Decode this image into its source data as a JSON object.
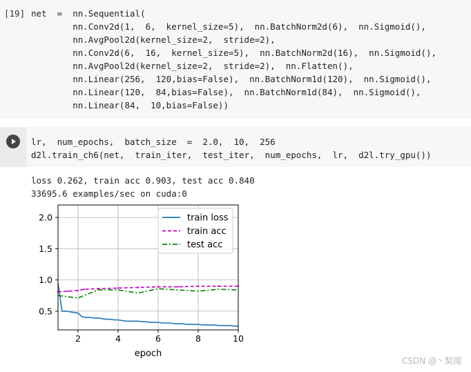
{
  "cell1": {
    "prompt": "[19]",
    "lines": [
      "net  =  nn.Sequential(",
      "        nn.Conv2d(1,  6,  kernel_size=5),  nn.BatchNorm2d(6),  nn.Sigmoid(),",
      "        nn.AvgPool2d(kernel_size=2,  stride=2),",
      "        nn.Conv2d(6,  16,  kernel_size=5),  nn.BatchNorm2d(16),  nn.Sigmoid(),",
      "        nn.AvgPool2d(kernel_size=2,  stride=2),  nn.Flatten(),",
      "        nn.Linear(256,  120,bias=False),  nn.BatchNorm1d(120),  nn.Sigmoid(),",
      "        nn.Linear(120,  84,bias=False),  nn.BatchNorm1d(84),  nn.Sigmoid(),",
      "        nn.Linear(84,  10,bias=False))"
    ]
  },
  "cell2": {
    "lines": [
      "lr,  num_epochs,  batch_size  =  2.0,  10,  256",
      "d2l.train_ch6(net,  train_iter,  test_iter,  num_epochs,  lr,  d2l.try_gpu())"
    ]
  },
  "output": {
    "line1": "loss 0.262, train acc 0.903, test acc 0.840",
    "line2": "33695.6 examples/sec on cuda:0"
  },
  "chart_data": {
    "type": "line",
    "xlabel": "epoch",
    "ylabel": "",
    "xlim": [
      1,
      10
    ],
    "ylim": [
      0.2,
      2.2
    ],
    "xticks": [
      "2",
      "4",
      "6",
      "8",
      "10"
    ],
    "yticks": [
      "0.5",
      "1.0",
      "1.5",
      "2.0"
    ],
    "grid": true,
    "legend_position": "top-right",
    "series": [
      {
        "name": "train loss",
        "color": "#1f77b4",
        "style": "solid",
        "x": [
          1.0,
          1.2,
          1.4,
          1.6,
          1.8,
          2.0,
          2.2,
          2.4,
          2.6,
          2.8,
          3.0,
          3.2,
          3.4,
          3.6,
          3.8,
          4.0,
          4.2,
          4.4,
          4.6,
          4.8,
          5.0,
          5.2,
          5.4,
          5.6,
          5.8,
          6.0,
          6.2,
          6.4,
          6.6,
          6.8,
          7.0,
          7.2,
          7.4,
          7.6,
          7.8,
          8.0,
          8.2,
          8.4,
          8.6,
          8.8,
          9.0,
          9.2,
          9.4,
          9.6,
          9.8,
          10.0
        ],
        "values": [
          0.95,
          0.5,
          0.5,
          0.49,
          0.48,
          0.47,
          0.41,
          0.4,
          0.4,
          0.39,
          0.39,
          0.38,
          0.37,
          0.37,
          0.36,
          0.36,
          0.35,
          0.34,
          0.34,
          0.34,
          0.34,
          0.33,
          0.33,
          0.32,
          0.32,
          0.32,
          0.31,
          0.31,
          0.31,
          0.3,
          0.3,
          0.3,
          0.29,
          0.29,
          0.29,
          0.29,
          0.28,
          0.28,
          0.28,
          0.28,
          0.27,
          0.27,
          0.27,
          0.27,
          0.26,
          0.26
        ]
      },
      {
        "name": "train acc",
        "color": "#bf00bf",
        "style": "dashed",
        "x": [
          1,
          1.5,
          2,
          2.3,
          3,
          4,
          5,
          6,
          7,
          8,
          9,
          10
        ],
        "values": [
          0.81,
          0.82,
          0.83,
          0.85,
          0.86,
          0.87,
          0.88,
          0.89,
          0.89,
          0.9,
          0.9,
          0.9
        ],
        "markers": true
      },
      {
        "name": "test acc",
        "color": "#008000",
        "style": "dashdot",
        "x": [
          1,
          2,
          3,
          4,
          5,
          6,
          7,
          8,
          9,
          10
        ],
        "values": [
          0.75,
          0.71,
          0.84,
          0.84,
          0.79,
          0.86,
          0.84,
          0.82,
          0.85,
          0.84
        ]
      }
    ]
  },
  "watermark": "CSDN @丶契阔"
}
